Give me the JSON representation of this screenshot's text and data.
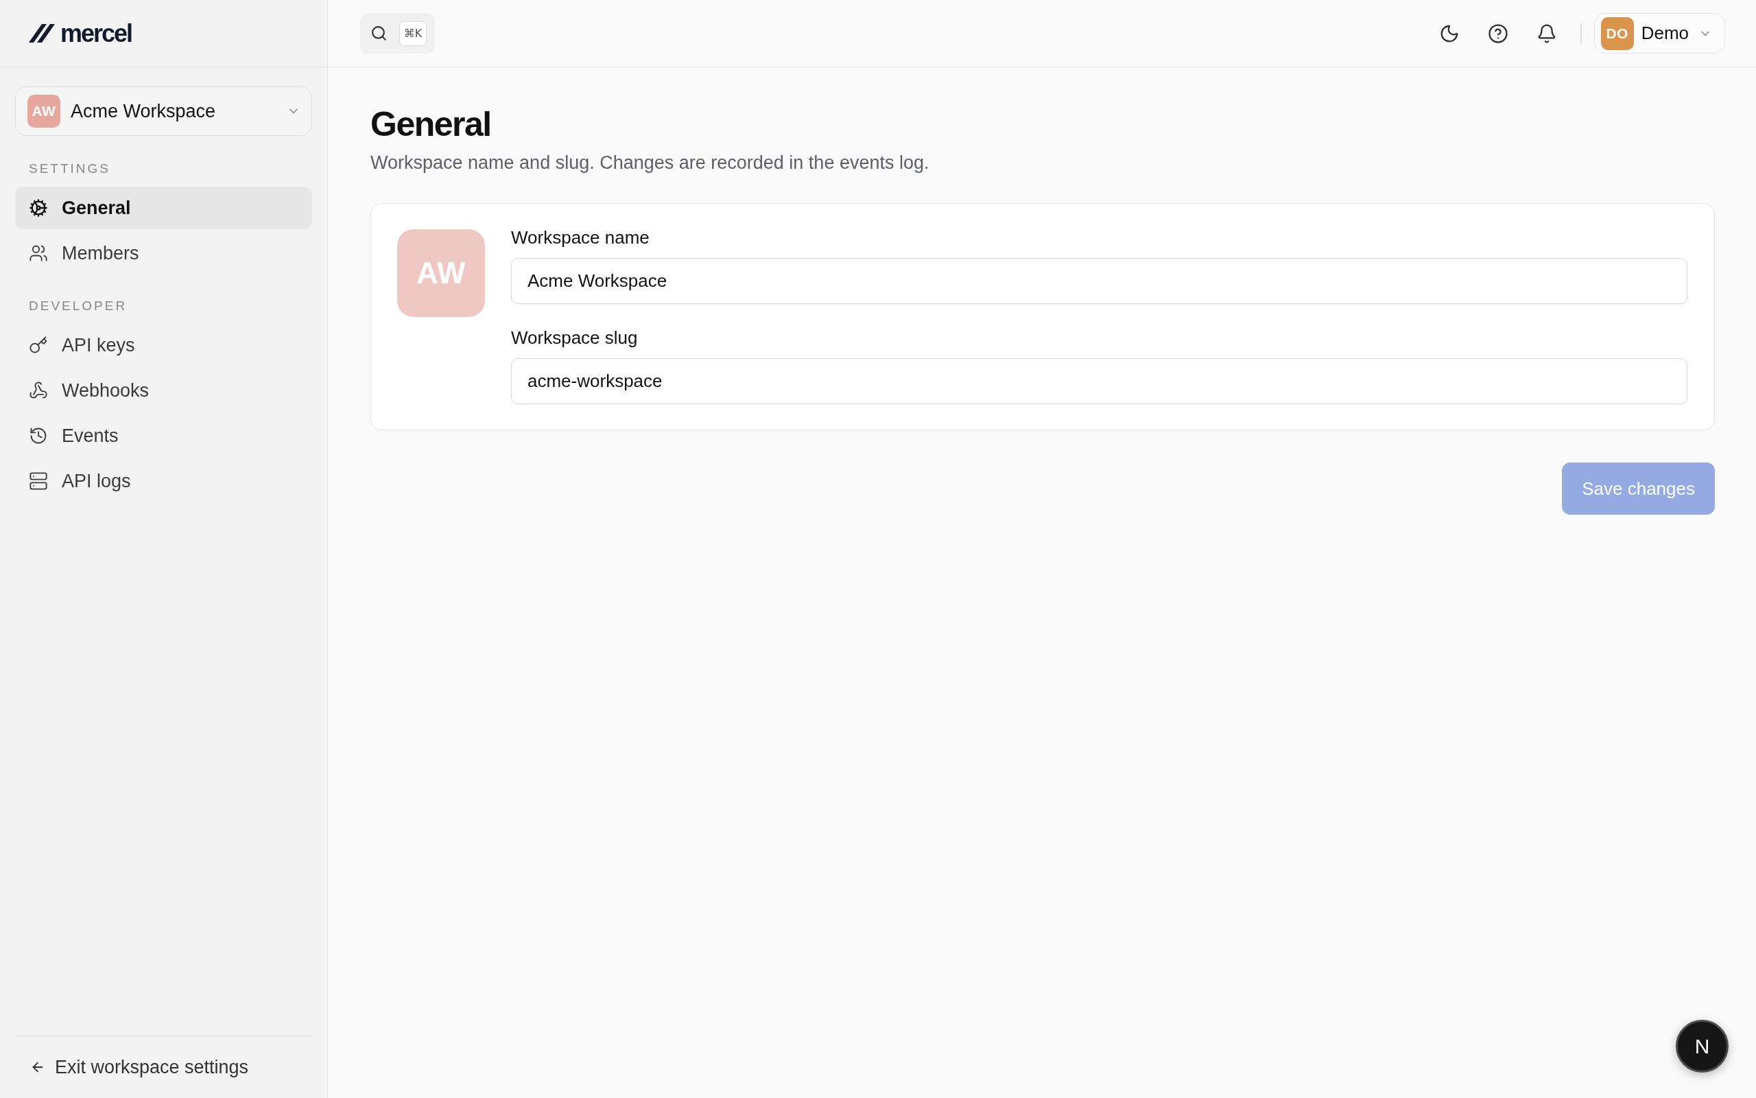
{
  "sidebar": {
    "logo": {
      "text": "mercel"
    },
    "workspace_switcher": {
      "initials": "AW",
      "name": "Acme Workspace"
    },
    "sections": [
      {
        "heading": "SETTINGS",
        "items": [
          {
            "label": "General",
            "selected": true
          },
          {
            "label": "Members",
            "selected": false
          }
        ]
      },
      {
        "heading": "DEVELOPER",
        "items": [
          {
            "label": "API keys",
            "selected": false
          },
          {
            "label": "Webhooks",
            "selected": false
          },
          {
            "label": "Events",
            "selected": false
          },
          {
            "label": "API logs",
            "selected": false
          }
        ]
      }
    ],
    "exit_link": {
      "label": "Exit workspace settings"
    }
  },
  "topbar": {
    "search": {
      "shortcut": "⌘K"
    },
    "user_menu": {
      "initials": "DO",
      "name": "Demo"
    }
  },
  "page": {
    "title": "General",
    "subtitle": "Workspace name and slug. Changes are recorded in the events log.",
    "card": {
      "avatar_initials": "AW",
      "fields": [
        {
          "label": "Workspace name",
          "value": "Acme Workspace"
        },
        {
          "label": "Workspace slug",
          "value": "acme-workspace"
        }
      ]
    },
    "save_button": {
      "label": "Save changes",
      "disabled": true
    }
  },
  "dev_indicator": {
    "label": "N"
  }
}
